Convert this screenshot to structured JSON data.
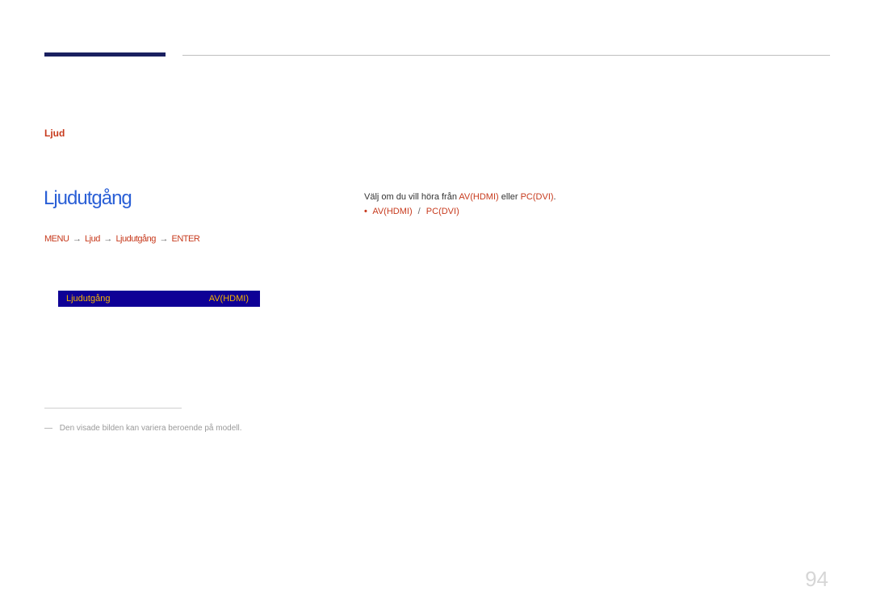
{
  "condition": {
    "text": "Ljud"
  },
  "heading": "Ljudutgång",
  "breadcrumb": {
    "menu": "MENU",
    "p1": "Ljud",
    "p2": "Ljudutgång",
    "enter": "ENTER"
  },
  "option": {
    "label": "Ljudutgång",
    "value": "AV(HDMI)"
  },
  "footnote": "Den visade bilden kan variera beroende på modell.",
  "desc1": {
    "pre": "Välj om du vill höra från ",
    "a": "AV(HDMI)",
    "mid": " eller ",
    "b": "PC(DVI)",
    "post": "."
  },
  "desc2": {
    "a": "AV(HDMI)",
    "b": "PC(DVI)"
  },
  "page": "94"
}
